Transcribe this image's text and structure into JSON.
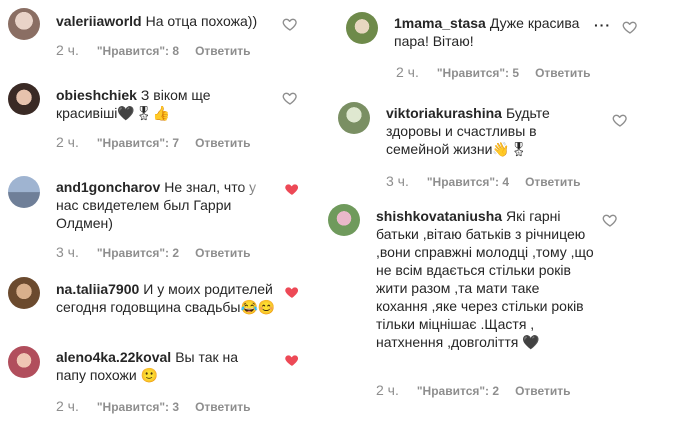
{
  "left": [
    {
      "user": "valeriiaworld",
      "text": "На отца похожа))",
      "time": "2 ч.",
      "likes": "\"Нравится\": 8",
      "reply": "Ответить",
      "liked": false
    },
    {
      "user": "obieshchiek",
      "text": "З віком ще красивіші🖤🎖👍",
      "time": "2 ч.",
      "likes": "\"Нравится\": 7",
      "reply": "Ответить",
      "liked": false
    },
    {
      "user": "and1goncharov",
      "text": "Не знал, что у нас свидетелем был Гарри Олдмен)",
      "time": "3 ч.",
      "likes": "\"Нравится\": 2",
      "reply": "Ответить",
      "liked": true
    },
    {
      "user": "na.taliia7900",
      "text": "И у моих родителей сегодня годовщина свадьбы😂😊",
      "time": "",
      "likes": "",
      "reply": "",
      "liked": true
    },
    {
      "user": "aleno4ka.22koval",
      "text": "Вы так на папу похожи 🙂",
      "time": "2 ч.",
      "likes": "\"Нравится\": 3",
      "reply": "Ответить",
      "liked": true
    }
  ],
  "right": [
    {
      "user": "1mama_stasa",
      "text": "Дуже красива пара! Вітаю!",
      "time": "2 ч.",
      "likes": "\"Нравится\": 5",
      "reply": "Ответить",
      "liked": false
    },
    {
      "user": "viktoriakurashina",
      "text": "Будьте здоровы и счастливы в семейной жизни👋🎖",
      "time": "3 ч.",
      "likes": "\"Нравится\": 4",
      "reply": "Ответить",
      "liked": false
    },
    {
      "user": "shishkovataniusha",
      "text": "Які гарні батьки ,вітаю батьків з річницею ,вони справжні молодці ,тому ,що не всім вдається стільки років жити разом ,та мати таке кохання ,яке через стільки років тільки міцнішає .Щастя , натхнення ,довголіття 🖤",
      "time": "2 ч.",
      "likes": "\"Нравится\": 2",
      "reply": "Ответить",
      "liked": false
    }
  ],
  "colors": {
    "text": "#262626",
    "meta": "#8e8e8e",
    "like": "#ed4956"
  },
  "icons": {
    "heart": "heart-icon",
    "more": "more-options-icon"
  }
}
